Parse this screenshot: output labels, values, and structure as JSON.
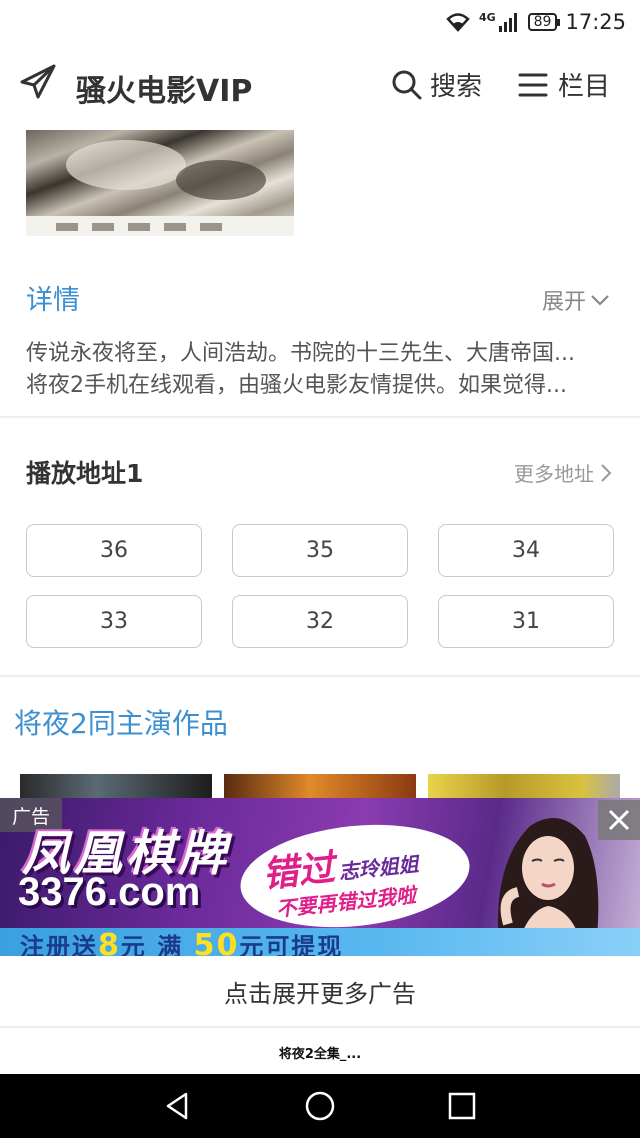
{
  "status_bar": {
    "network": "4G",
    "battery": "89",
    "time": "17:25"
  },
  "header": {
    "title": "骚火电影VIP",
    "search_label": "搜索",
    "menu_label": "栏目",
    "icons": [
      "send-icon",
      "search-icon",
      "menu-icon"
    ]
  },
  "details": {
    "title": "详情",
    "expand_label": "展开",
    "lines": [
      "传说永夜将至，人间浩劫。书院的十三先生、大唐帝国...",
      "将夜2手机在线观看，由骚火电影友情提供。如果觉得..."
    ]
  },
  "play": {
    "title": "播放地址1",
    "more_label": "更多地址",
    "episodes": [
      "36",
      "35",
      "34",
      "33",
      "32",
      "31"
    ]
  },
  "related": {
    "title": "将夜2同主演作品"
  },
  "ad": {
    "tag": "广告",
    "brand": "凤凰棋牌",
    "domain": "3376.com",
    "bubble_big": "错过",
    "bubble_small": "志玲姐姐",
    "bubble_line2": "不要再错过我啦",
    "bar_text_pre": "注册送",
    "bar_num1": "8",
    "bar_text_mid": "元  满",
    "bar_num2": "50",
    "bar_text_post": "元可提现",
    "more_label": "点击展开更多广告"
  },
  "footer": {
    "title": "将夜2全集_..."
  },
  "colors": {
    "accent_blue": "#3c8fd0",
    "ad_purple": "#6b2a9a",
    "nav_bg": "#000000"
  }
}
